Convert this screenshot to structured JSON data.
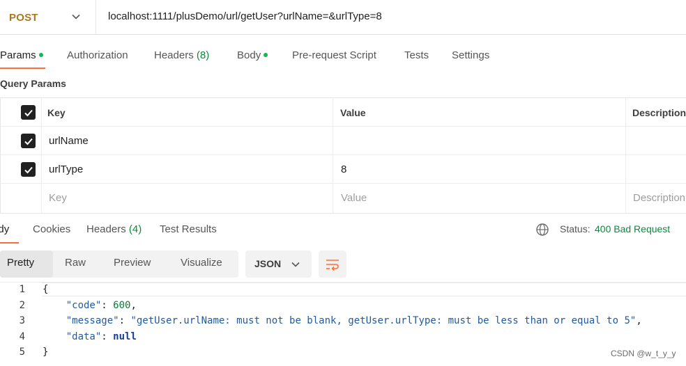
{
  "request": {
    "method": "POST",
    "url": "localhost:1111/plusDemo/url/getUser?urlName=&urlType=8"
  },
  "request_tabs": {
    "params": "Params",
    "authorization": "Authorization",
    "headers": "Headers",
    "headers_count": "(8)",
    "body": "Body",
    "pre_request": "Pre-request Script",
    "tests": "Tests",
    "settings": "Settings"
  },
  "query_params": {
    "title": "Query Params",
    "columns": {
      "key": "Key",
      "value": "Value",
      "description": "Description"
    },
    "rows": [
      {
        "key": "urlName",
        "value": "",
        "checked": true
      },
      {
        "key": "urlType",
        "value": "8",
        "checked": true
      }
    ],
    "placeholder": {
      "key": "Key",
      "value": "Value",
      "description": "Description"
    }
  },
  "response_tabs": {
    "body": "Body",
    "cookies": "Cookies",
    "headers": "Headers",
    "headers_count": "(4)",
    "test_results": "Test Results"
  },
  "status": {
    "label": "Status:",
    "value": "400 Bad Request"
  },
  "view_modes": {
    "pretty": "Pretty",
    "raw": "Raw",
    "preview": "Preview",
    "visualize": "Visualize"
  },
  "format": "JSON",
  "response_body": {
    "line_numbers": [
      "1",
      "2",
      "3",
      "4",
      "5"
    ],
    "open_brace": "{",
    "close_brace": "}",
    "code_key": "\"code\"",
    "code_value": "600",
    "message_key": "\"message\"",
    "message_value": "\"getUser.urlName: must not be blank, getUser.urlType: must be less than or equal to 5\"",
    "data_key": "\"data\"",
    "data_value": "null"
  },
  "watermark": "CSDN @w_t_y_y",
  "colors": {
    "method": "#a9791d",
    "accent": "#ff6c37",
    "success": "#0a8a3c",
    "dot": "#0cbb52"
  }
}
